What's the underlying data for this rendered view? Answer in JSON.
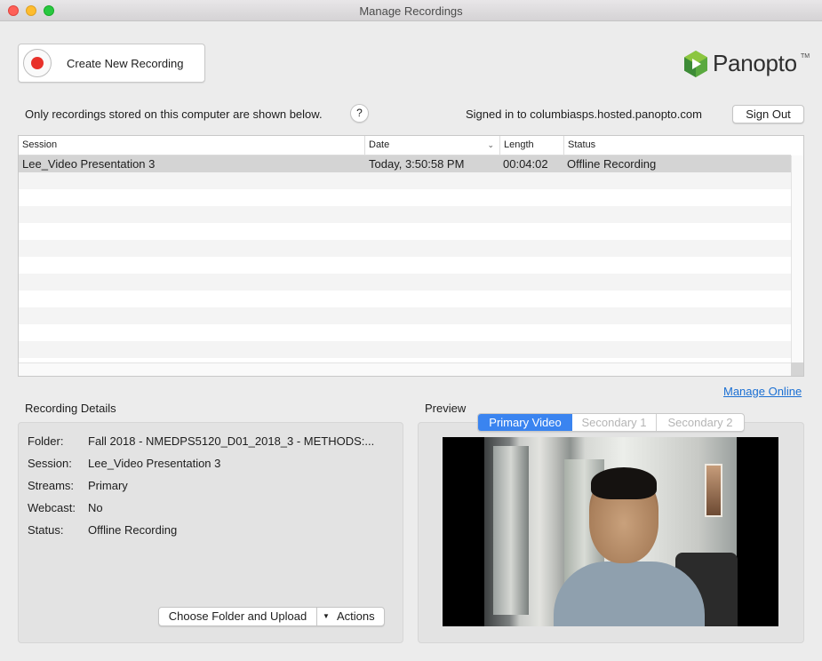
{
  "window": {
    "title": "Manage Recordings"
  },
  "toolbar": {
    "create_label": "Create New Recording"
  },
  "brand": {
    "logo_text": "Panopto",
    "trademark": "TM",
    "logo_colors": [
      "#3f9c35",
      "#7cc242",
      "#2e7d32"
    ]
  },
  "info": {
    "text": "Only recordings stored on this computer are shown below.",
    "help_label": "?",
    "signed_in": "Signed in to columbiasps.hosted.panopto.com",
    "sign_out_label": "Sign Out"
  },
  "table": {
    "columns": [
      "Session",
      "Date",
      "Length",
      "Status"
    ],
    "sorted_column": "Date",
    "rows": [
      {
        "session": "Lee_Video Presentation 3",
        "date": "Today, 3:50:58 PM",
        "length": "00:04:02",
        "status": "Offline Recording",
        "selected": true
      }
    ]
  },
  "links": {
    "manage_online": "Manage Online"
  },
  "details": {
    "heading": "Recording Details",
    "fields": [
      {
        "key": "Folder:",
        "value": "Fall 2018 - NMEDPS5120_D01_2018_3 - METHODS:..."
      },
      {
        "key": "Session:",
        "value": "Lee_Video Presentation 3"
      },
      {
        "key": "Streams:",
        "value": "Primary"
      },
      {
        "key": "Webcast:",
        "value": "No"
      },
      {
        "key": "Status:",
        "value": "Offline Recording"
      }
    ],
    "upload_label": "Choose Folder and Upload",
    "actions_label": "Actions"
  },
  "preview": {
    "heading": "Preview",
    "tabs": [
      "Primary Video",
      "Secondary 1",
      "Secondary 2"
    ],
    "active_tab": "Primary Video"
  },
  "colors": {
    "record_red": "#e8312a",
    "accent_blue": "#3a84f0",
    "link_blue": "#1a6fd3",
    "selection_gray": "#d4d4d4"
  }
}
